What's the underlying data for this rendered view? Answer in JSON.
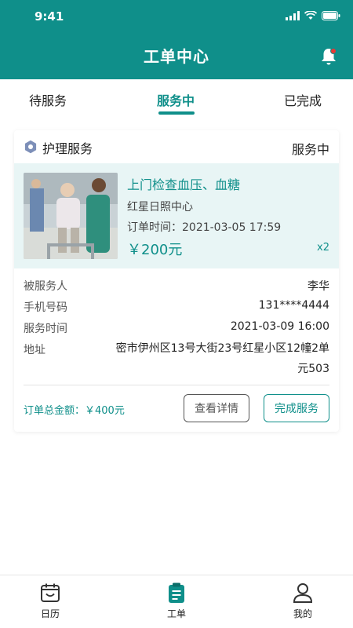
{
  "status_bar": {
    "time": "9:41"
  },
  "header": {
    "title": "工单中心"
  },
  "tabs": [
    {
      "label": "待服务"
    },
    {
      "label": "服务中"
    },
    {
      "label": "已完成"
    }
  ],
  "active_tab": "服务中",
  "order": {
    "service_type": "护理服务",
    "status": "服务中",
    "product_name": "上门检查血压、血糖",
    "center": "红星日照中心",
    "order_time": "订单时间：2021-03-05 17:59",
    "price": "￥200元",
    "quantity": "x2",
    "info": [
      {
        "label": "被服务人",
        "value": "李华"
      },
      {
        "label": "手机号码",
        "value": "131****4444"
      },
      {
        "label": "服务时间",
        "value": "2021-03-09 16:00"
      },
      {
        "label": "地址",
        "value": "密市伊州区13号大街23号红星小区12幢2单元503"
      }
    ],
    "total": "订单总金额：￥400元",
    "detail_button": "查看详情",
    "complete_button": "完成服务"
  },
  "bottom_nav": [
    {
      "label": "日历",
      "icon": "calendar-icon"
    },
    {
      "label": "工单",
      "icon": "clipboard-icon"
    },
    {
      "label": "我的",
      "icon": "user-icon"
    }
  ],
  "colors": {
    "primary": "#0f8f8a",
    "card_highlight": "#e8f5f5",
    "notification_dot": "#e53935"
  }
}
